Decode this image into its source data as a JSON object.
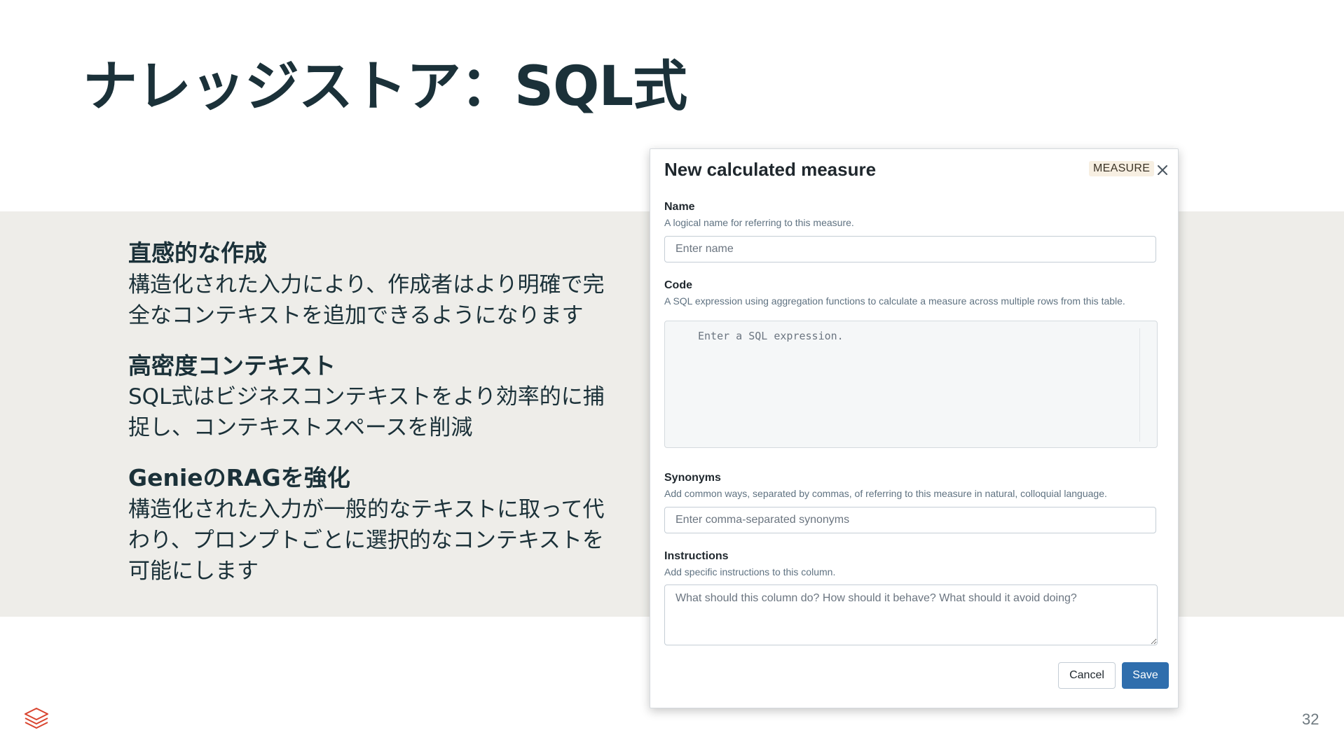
{
  "slide": {
    "title": "ナレッジストア：SQL式",
    "page_number": "32"
  },
  "points": [
    {
      "heading": "直感的な作成",
      "body": "構造化された入力により、作成者はより明確で完全なコンテキストを追加できるようになります"
    },
    {
      "heading": "高密度コンテキスト",
      "body": "SQL式はビジネスコンテキストをより効率的に捕捉し、コンテキストスペースを削減"
    },
    {
      "heading": "GenieのRAGを強化",
      "body": "構造化された入力が一般的なテキストに取って代わり、プロンプトごとに選択的なコンテキストを可能にします"
    }
  ],
  "modal": {
    "title": "New calculated measure",
    "badge": "MEASURE",
    "close_icon": "close-icon",
    "name": {
      "label": "Name",
      "help": "A logical name for referring to this measure.",
      "placeholder": "Enter name"
    },
    "code": {
      "label": "Code",
      "help": "A SQL expression using aggregation functions to calculate a measure across multiple rows from this table.",
      "placeholder": "Enter a SQL expression."
    },
    "synonyms": {
      "label": "Synonyms",
      "help": "Add common ways, separated by commas, of referring to this measure in natural, colloquial language.",
      "placeholder": "Enter comma-separated synonyms"
    },
    "instructions": {
      "label": "Instructions",
      "help": "Add specific instructions to this column.",
      "placeholder": "What should this column do? How should it behave? What should it avoid doing?"
    },
    "cancel_label": "Cancel",
    "save_label": "Save"
  },
  "colors": {
    "title_text": "#1b3139",
    "band_bg": "#eeede9",
    "save_button": "#2f6ead",
    "logo": "#d9442f"
  },
  "icons": [
    "close-icon",
    "databricks-logo-icon"
  ]
}
